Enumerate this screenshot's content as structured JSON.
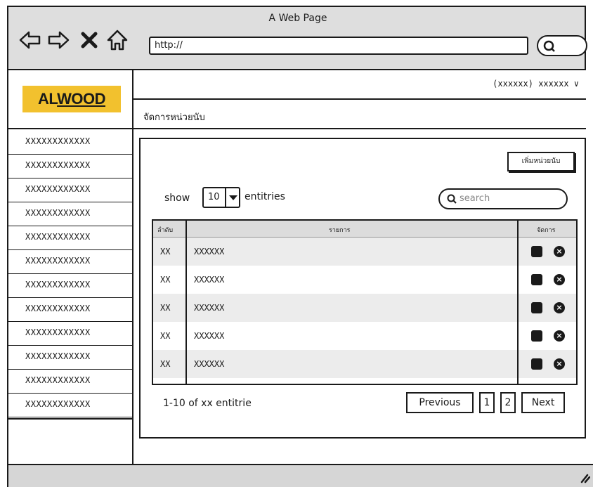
{
  "browser": {
    "title": "A Web Page",
    "url": "http://"
  },
  "logo": {
    "prefix": "AL",
    "suffix": "WOOD"
  },
  "sidebar": {
    "items": [
      {
        "label": "XXXXXXXXXXXX"
      },
      {
        "label": "XXXXXXXXXXXX"
      },
      {
        "label": "XXXXXXXXXXXX"
      },
      {
        "label": "XXXXXXXXXXXX"
      },
      {
        "label": "XXXXXXXXXXXX"
      },
      {
        "label": "XXXXXXXXXXXX"
      },
      {
        "label": "XXXXXXXXXXXX"
      },
      {
        "label": "XXXXXXXXXXXX"
      },
      {
        "label": "XXXXXXXXXXXX"
      },
      {
        "label": "XXXXXXXXXXXX"
      },
      {
        "label": "XXXXXXXXXXXX"
      },
      {
        "label": "XXXXXXXXXXXX"
      }
    ]
  },
  "header": {
    "user_menu": "(xxxxxx) xxxxxx ∨",
    "breadcrumb": "จัดการหน่วยนับ"
  },
  "main": {
    "add_button": "เพิ่มหน่วยนับ",
    "show_label": "show",
    "entries_value": "10",
    "entries_label": "entitries",
    "search_placeholder": "search",
    "table": {
      "columns": [
        "ลำดับ",
        "รายการ",
        "จัดการ"
      ],
      "rows": [
        {
          "no": "XX",
          "item": "XXXXXX"
        },
        {
          "no": "XX",
          "item": "XXXXXX"
        },
        {
          "no": "XX",
          "item": "XXXXXX"
        },
        {
          "no": "XX",
          "item": "XXXXXX"
        },
        {
          "no": "XX",
          "item": "XXXXXX"
        }
      ]
    },
    "summary": "1-10 of xx entitrie",
    "pagination": {
      "previous": "Previous",
      "pages": [
        "1",
        "2"
      ],
      "next": "Next"
    }
  }
}
